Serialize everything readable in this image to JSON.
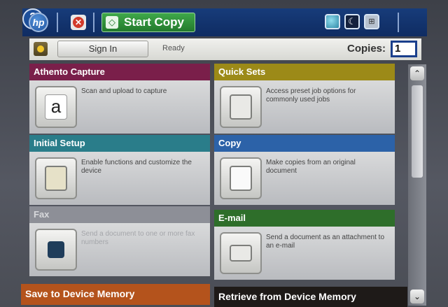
{
  "topbar": {
    "logo_text": "hp",
    "stop_icon": "stop-icon",
    "start_label": "Start Copy",
    "start_icon": "start-diamond-icon",
    "help_text": "?"
  },
  "status": {
    "home_icon": "home-icon",
    "signin_label": "Sign In",
    "status_text": "Ready",
    "copies_label": "Copies:",
    "copies_value": "1"
  },
  "tiles": [
    {
      "title": "Athento Capture",
      "desc": "Scan and upload to capture",
      "color": "#7a1f4a",
      "icon": "athento-logo-icon"
    },
    {
      "title": "Quick Sets",
      "desc": "Access preset job options for commonly used jobs",
      "color": "#9c8a18",
      "icon": "clipboard-icon"
    },
    {
      "title": "Initial Setup",
      "desc": "Enable functions and customize the device",
      "color": "#2a7d8a",
      "icon": "clipboard-setup-icon"
    },
    {
      "title": "Copy",
      "desc": "Make copies from an original document",
      "color": "#2c62a8",
      "icon": "copy-pages-icon"
    },
    {
      "title": "Fax",
      "desc": "Send a document to one or more fax numbers",
      "color": "#8d8f97",
      "icon": "fax-icon"
    },
    {
      "title": "E-mail",
      "desc": "Send a document as an attachment to an e-mail",
      "color": "#2e6e2a",
      "icon": "envelope-icon"
    },
    {
      "title": "Save to Device Memory",
      "color": "#b4531c"
    },
    {
      "title": "Retrieve from Device Memory",
      "color": "#1e1a18"
    }
  ],
  "scrollbar": {
    "up": "⌃",
    "down": "⌄"
  }
}
